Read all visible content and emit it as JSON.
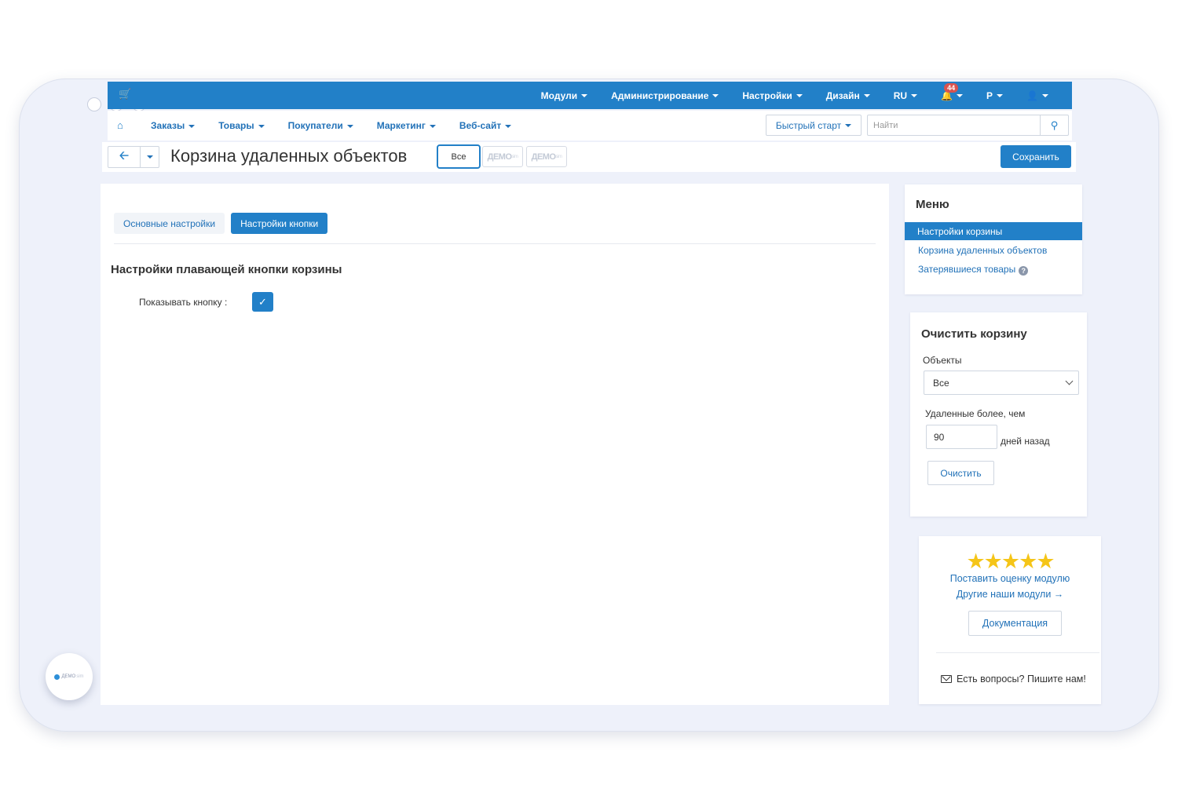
{
  "topnav": {
    "items": [
      "Модули",
      "Администрирование",
      "Настройки",
      "Дизайн",
      "RU"
    ],
    "notifications_count": "44",
    "currency": "Р"
  },
  "subnav": {
    "links": [
      "Заказы",
      "Товары",
      "Покупатели",
      "Маркетинг",
      "Веб-сайт"
    ],
    "quick_start": "Быстрый старт",
    "search_placeholder": "Найти"
  },
  "header": {
    "title": "Корзина удаленных объектов",
    "filter_label": "Все",
    "demo_label": "ДЕМО",
    "demo_sup": "sim",
    "save_label": "Сохранить"
  },
  "main": {
    "tabs": [
      {
        "label": "Основные настройки",
        "active": false
      },
      {
        "label": "Настройки кнопки",
        "active": true
      }
    ],
    "section_title": "Настройки плавающей кнопки корзины",
    "show_button_label": "Показывать кнопку :",
    "show_button_checked": true
  },
  "menu": {
    "title": "Меню",
    "items": [
      "Настройки корзины",
      "Корзина удаленных объектов",
      "Затерявшиеся товары"
    ],
    "active_index": 0
  },
  "clear": {
    "title": "Очистить корзину",
    "objects_label": "Объекты",
    "objects_value": "Все",
    "older_than_label": "Удаленные более, чем",
    "days_value": "90",
    "days_suffix": "дней назад",
    "button_label": "Очистить"
  },
  "rating": {
    "stars": 5,
    "rate_link": "Поставить оценку модулю",
    "other_link": "Другие наши модули →",
    "docs_button": "Документация",
    "contact_text": "Есть вопросы? Пишите нам!"
  },
  "brand": {
    "demo_badge": "ДЕМО",
    "demo_badge_sub": "sim",
    "accent_color": "#2280c8"
  }
}
